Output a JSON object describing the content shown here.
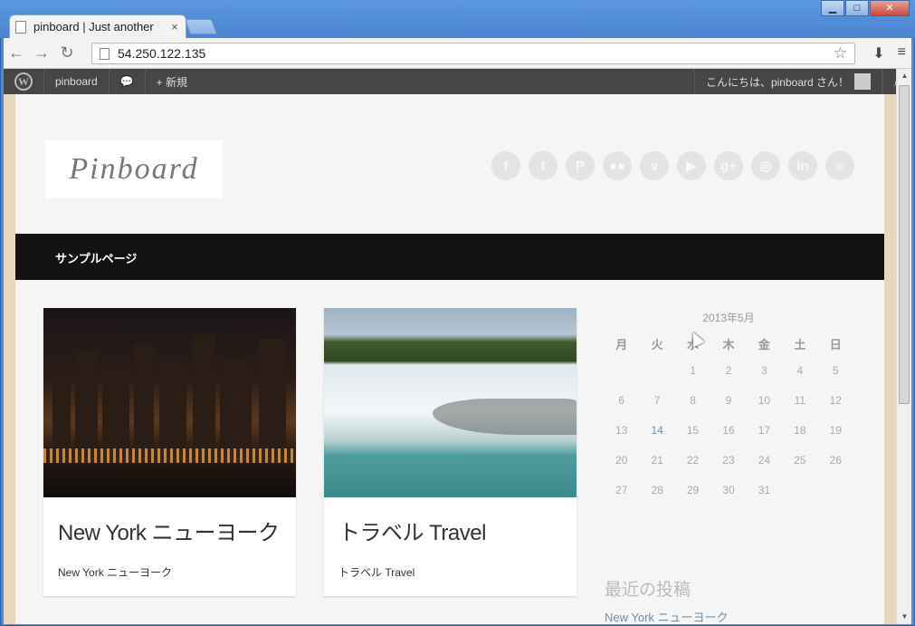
{
  "browser": {
    "tab_title": "pinboard | Just another",
    "tab_close": "×",
    "url": "54.250.122.135",
    "window_controls": [
      "▁",
      "□",
      "✕"
    ]
  },
  "adminbar": {
    "site_name": "pinboard",
    "new_label": "+ 新規",
    "greeting": "こんにちは、pinboard さん！"
  },
  "site": {
    "logo_text": "Pinboard",
    "social_icons": [
      "facebook-icon",
      "twitter-icon",
      "pinterest-icon",
      "flickr-icon",
      "vimeo-icon",
      "youtube-icon",
      "google-plus-icon",
      "dribbble-icon",
      "linkedin-icon",
      "search-icon"
    ],
    "nav": {
      "sample_page": "サンプルページ"
    }
  },
  "posts": [
    {
      "title": "New York ニューヨーク",
      "excerpt": "New York ニューヨーク"
    },
    {
      "title": "トラベル Travel",
      "excerpt": "トラベル Travel"
    }
  ],
  "calendar": {
    "caption": "2013年5月",
    "weekdays": [
      "月",
      "火",
      "水",
      "木",
      "金",
      "土",
      "日"
    ],
    "weeks": [
      [
        "",
        "",
        "1",
        "2",
        "3",
        "4",
        "5"
      ],
      [
        "6",
        "7",
        "8",
        "9",
        "10",
        "11",
        "12"
      ],
      [
        "13",
        "14",
        "15",
        "16",
        "17",
        "18",
        "19"
      ],
      [
        "20",
        "21",
        "22",
        "23",
        "24",
        "25",
        "26"
      ],
      [
        "27",
        "28",
        "29",
        "30",
        "31",
        "",
        ""
      ]
    ],
    "linked_day": "14"
  },
  "recent_posts": {
    "title": "最近の投稿",
    "items": [
      "New York ニューヨーク"
    ]
  }
}
